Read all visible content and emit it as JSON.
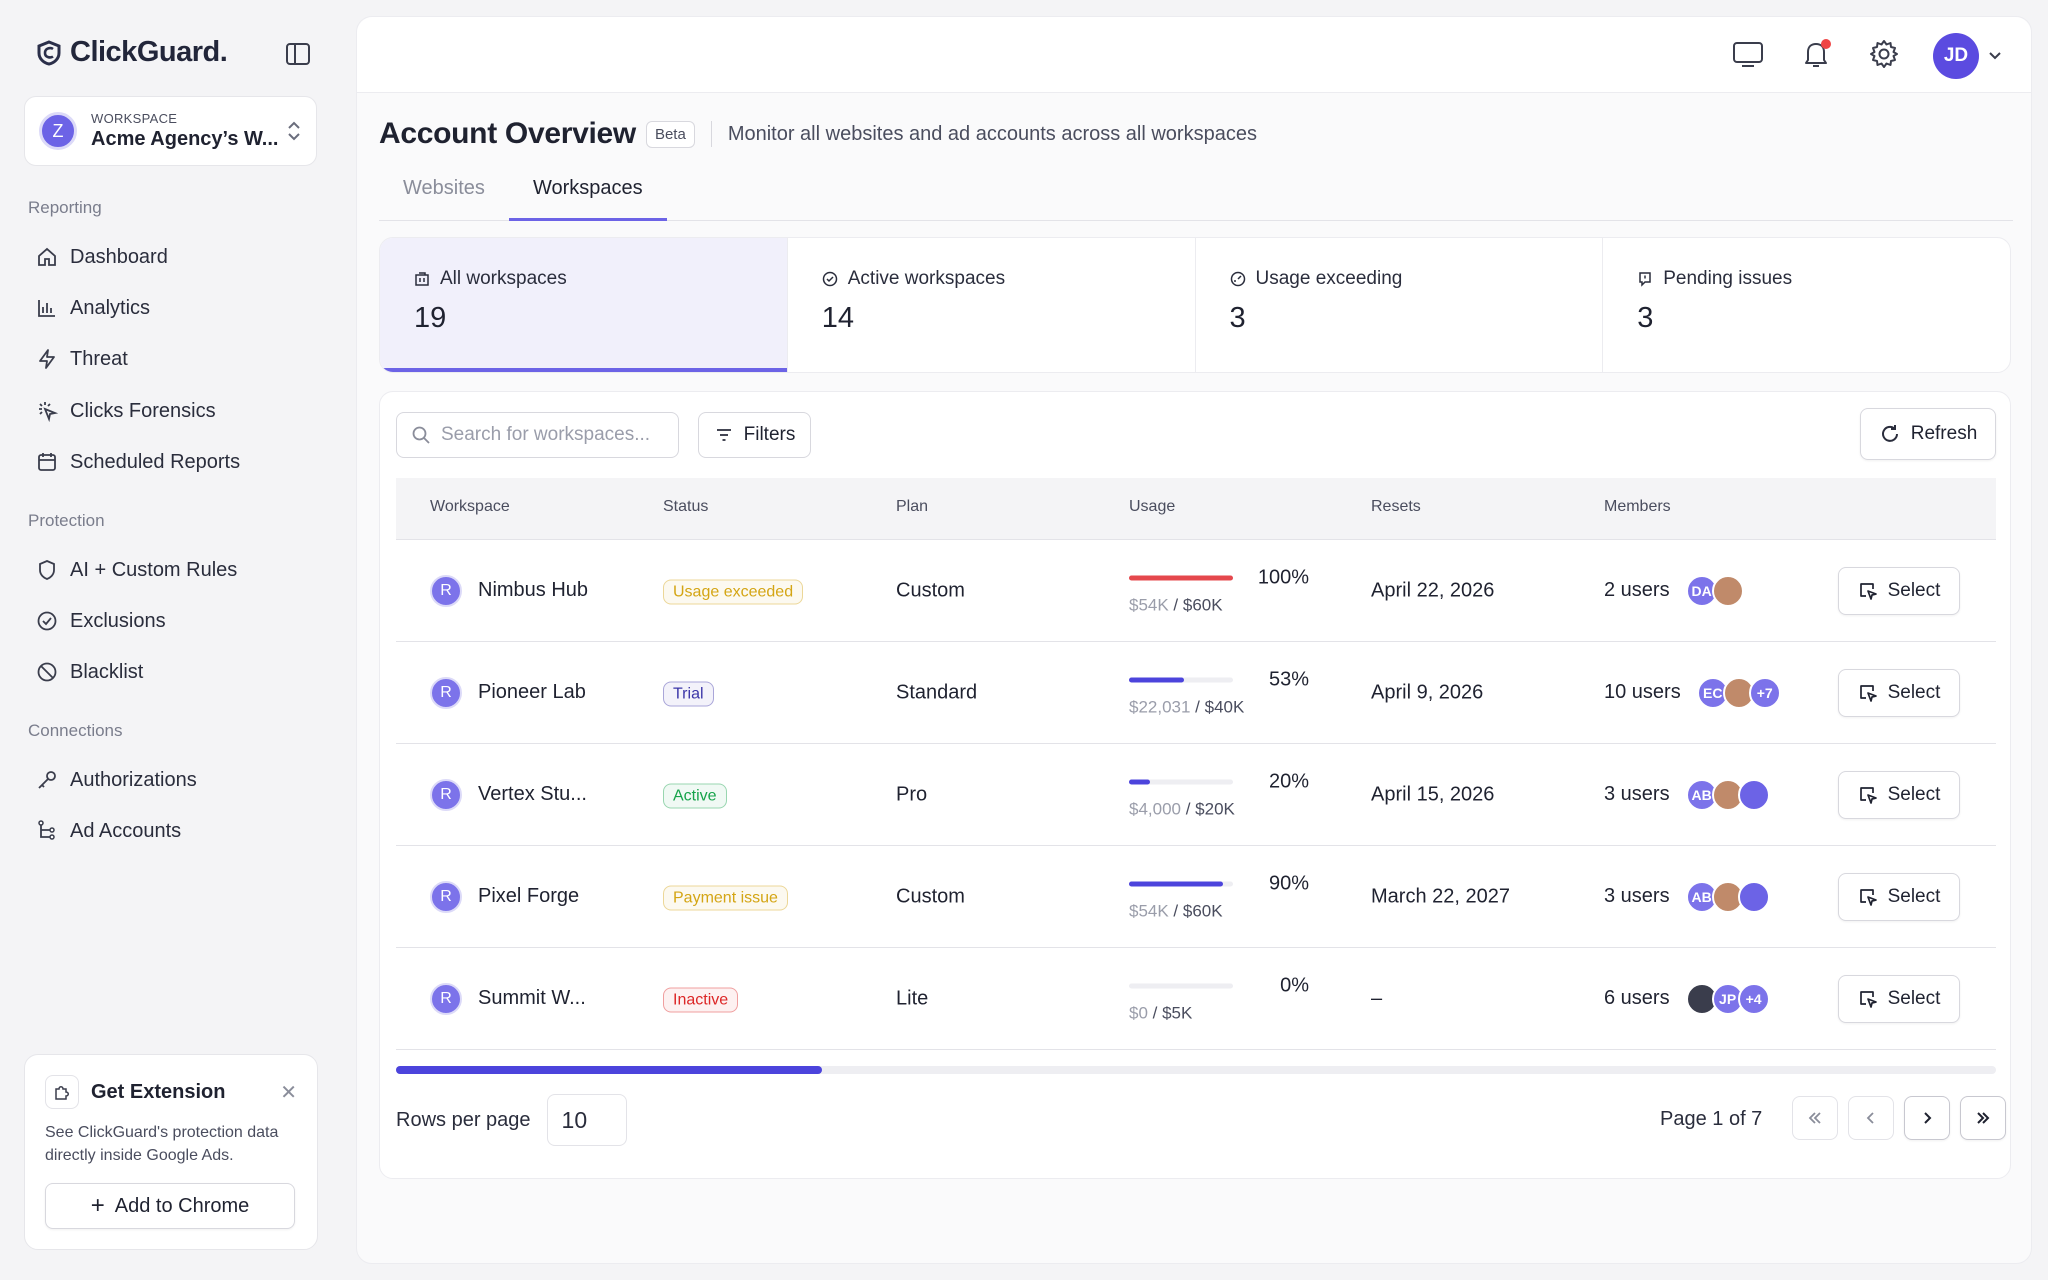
{
  "brand": {
    "name": "ClickGuard",
    "dot": "."
  },
  "workspace_switcher": {
    "label": "WORKSPACE",
    "name": "Acme Agency’s W...",
    "avatar": "Z"
  },
  "sidebar": {
    "sections": [
      {
        "title": "Reporting",
        "items": [
          {
            "label": "Dashboard",
            "icon": "home-icon"
          },
          {
            "label": "Analytics",
            "icon": "bar-chart-icon"
          },
          {
            "label": "Threat",
            "icon": "lightning-icon"
          },
          {
            "label": "Clicks Forensics",
            "icon": "click-sparkle-icon"
          },
          {
            "label": "Scheduled Reports",
            "icon": "calendar-icon"
          }
        ]
      },
      {
        "title": "Protection",
        "items": [
          {
            "label": "AI + Custom Rules",
            "icon": "shield-icon"
          },
          {
            "label": "Exclusions",
            "icon": "check-circle-icon"
          },
          {
            "label": "Blacklist",
            "icon": "ban-icon"
          }
        ]
      },
      {
        "title": "Connections",
        "items": [
          {
            "label": "Authorizations",
            "icon": "key-icon"
          },
          {
            "label": "Ad Accounts",
            "icon": "hierarchy-icon"
          }
        ]
      }
    ]
  },
  "extension_card": {
    "title": "Get Extension",
    "description": "See ClickGuard's protection data directly inside Google Ads.",
    "button": "Add to Chrome"
  },
  "topbar": {
    "user_initials": "JD"
  },
  "page": {
    "title": "Account Overview",
    "badge": "Beta",
    "subtitle": "Monitor all websites and ad accounts across all workspaces"
  },
  "tabs": [
    {
      "label": "Websites",
      "active": false
    },
    {
      "label": "Workspaces",
      "active": true
    }
  ],
  "stats": [
    {
      "label": "All workspaces",
      "value": "19",
      "active": true
    },
    {
      "label": "Active workspaces",
      "value": "14",
      "active": false
    },
    {
      "label": "Usage exceeding",
      "value": "3",
      "active": false
    },
    {
      "label": "Pending issues",
      "value": "3",
      "active": false
    }
  ],
  "toolbar": {
    "search_placeholder": "Search for workspaces...",
    "filters": "Filters",
    "refresh": "Refresh"
  },
  "table": {
    "columns": [
      "Workspace",
      "Status",
      "Plan",
      "Usage",
      "Resets",
      "Members"
    ],
    "rows": [
      {
        "avatar": "R",
        "name": "Nimbus Hub",
        "status": "Usage exceeded",
        "status_color": "#d4a514",
        "plan": "Custom",
        "usage_pct": "100%",
        "usage_fraction": 1.0,
        "bar_color": "#e5484d",
        "used": "$54K",
        "sep": " / ",
        "limit": "$60K",
        "resets": "April 22, 2026",
        "members": "2 users",
        "avatars": [
          "DA",
          ""
        ],
        "extra": "",
        "select": "Select"
      },
      {
        "avatar": "R",
        "name": "Pioneer Lab",
        "status": "Trial",
        "status_color": "#3b35a8",
        "plan": "Standard",
        "usage_pct": "53%",
        "usage_fraction": 0.53,
        "bar_color": "#4c44dc",
        "used": "$22,031",
        "sep": " / ",
        "limit": "$40K",
        "resets": "April 9, 2026",
        "members": "10 users",
        "avatars": [
          "EC",
          ""
        ],
        "extra": "+7",
        "select": "Select"
      },
      {
        "avatar": "R",
        "name": "Vertex Stu...",
        "status": "Active",
        "status_color": "#16a34a",
        "plan": "Pro",
        "usage_pct": "20%",
        "usage_fraction": 0.2,
        "bar_color": "#4c44dc",
        "used": "$4,000",
        "sep": " / ",
        "limit": "$20K",
        "resets": "April 15, 2026",
        "members": "3 users",
        "avatars": [
          "AB",
          "",
          ""
        ],
        "extra": "",
        "select": "Select"
      },
      {
        "avatar": "R",
        "name": "Pixel Forge",
        "status": "Payment issue",
        "status_color": "#d4a514",
        "plan": "Custom",
        "usage_pct": "90%",
        "usage_fraction": 0.9,
        "bar_color": "#4c44dc",
        "used": "$54K",
        "sep": " / ",
        "limit": "$60K",
        "resets": "March 22, 2027",
        "members": "3 users",
        "avatars": [
          "AB",
          "",
          ""
        ],
        "extra": "",
        "select": "Select"
      },
      {
        "avatar": "R",
        "name": "Summit W...",
        "status": "Inactive",
        "status_color": "#dc2626",
        "plan": "Lite",
        "usage_pct": "0%",
        "usage_fraction": 0.0,
        "bar_color": "#4c44dc",
        "used": "$0",
        "sep": " / ",
        "limit": "$5K",
        "resets": "–",
        "members": "6 users",
        "avatars": [
          "",
          "JP"
        ],
        "extra": "+4",
        "select": "Select"
      }
    ]
  },
  "pagination": {
    "rows_per_page_label": "Rows per page",
    "rows_per_page": "10",
    "page_info": "Page 1 of 7"
  },
  "colors": {
    "accent": "#6c63e6",
    "accent_dark": "#4c44dc"
  }
}
